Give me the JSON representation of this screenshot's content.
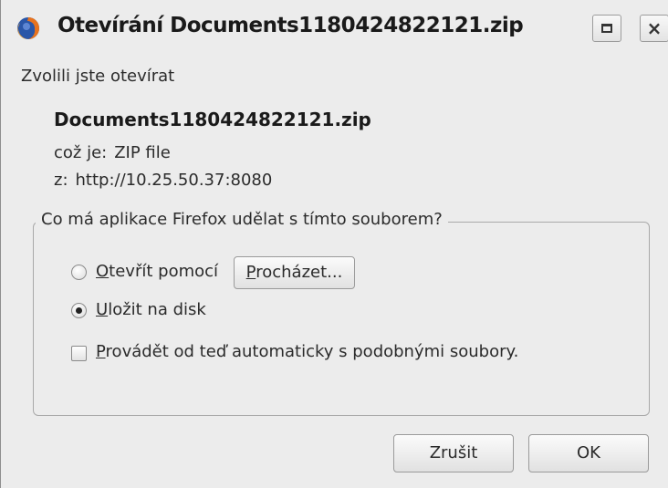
{
  "window": {
    "title": "Otevírání Documents1180424822121.zip",
    "icon": "firefox-icon",
    "maximize_icon": "maximize-icon",
    "close_glyph": "×"
  },
  "body": {
    "intro": "Zvolili jste otevírat",
    "filename": "Documents1180424822121.zip",
    "type_label": "což je:",
    "type_value": "ZIP file",
    "from_label": "z:",
    "from_value": "http://10.25.50.37:8080"
  },
  "action_group": {
    "legend": "Co má aplikace Firefox udělat s tímto souborem?",
    "open_with": {
      "mnemonic": "O",
      "rest": "tevřít pomocí",
      "selected": false
    },
    "browse_button": {
      "mnemonic": "P",
      "rest": "rocházet..."
    },
    "save_to_disk": {
      "mnemonic": "U",
      "rest": "ložit na disk",
      "selected": true
    },
    "auto_checkbox": {
      "mnemonic": "P",
      "rest": "rovádět od teď automaticky s podobnými soubory.",
      "checked": false
    }
  },
  "buttons": {
    "cancel": "Zrušit",
    "ok": "OK"
  }
}
